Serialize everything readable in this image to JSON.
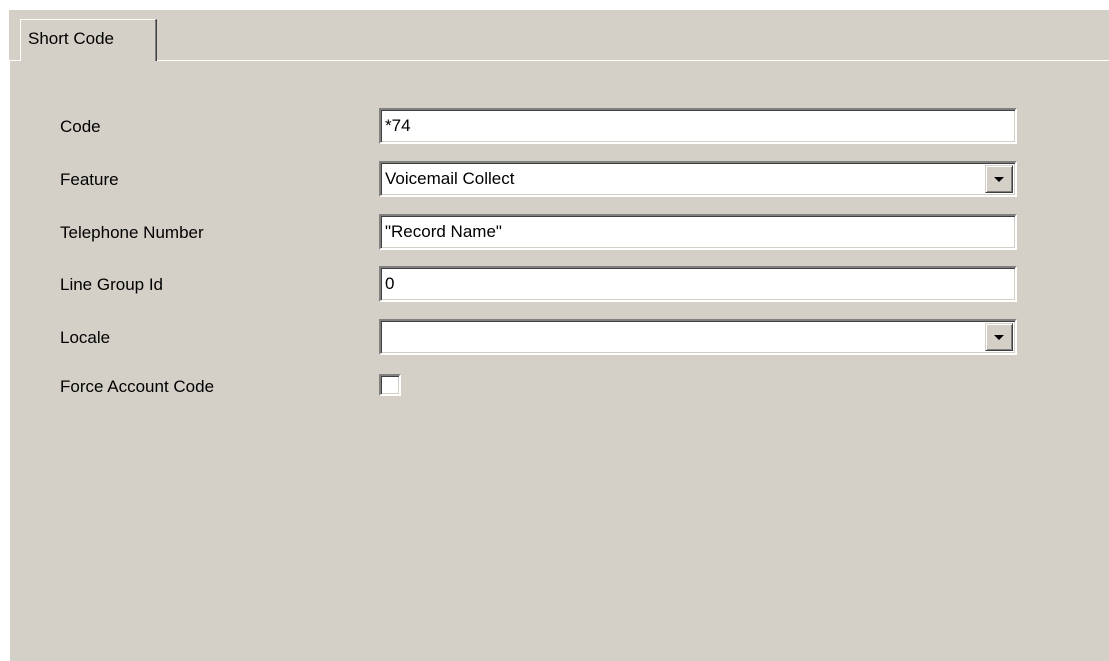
{
  "tabs": [
    {
      "label": "Short Code",
      "selected": true
    }
  ],
  "form": {
    "code": {
      "label": "Code",
      "value": "*74"
    },
    "feature": {
      "label": "Feature",
      "value": "Voicemail Collect"
    },
    "telephone_number": {
      "label": "Telephone Number",
      "value": "\"Record Name\""
    },
    "line_group_id": {
      "label": "Line Group Id",
      "value": "0"
    },
    "locale": {
      "label": "Locale",
      "value": ""
    },
    "force_account_code": {
      "label": "Force Account Code",
      "checked": false
    }
  },
  "icons": {
    "dropdown": "chevron-down-icon"
  },
  "colors": {
    "panel_background": "#d4d0c8",
    "input_background": "#ffffff",
    "text": "#000000"
  }
}
